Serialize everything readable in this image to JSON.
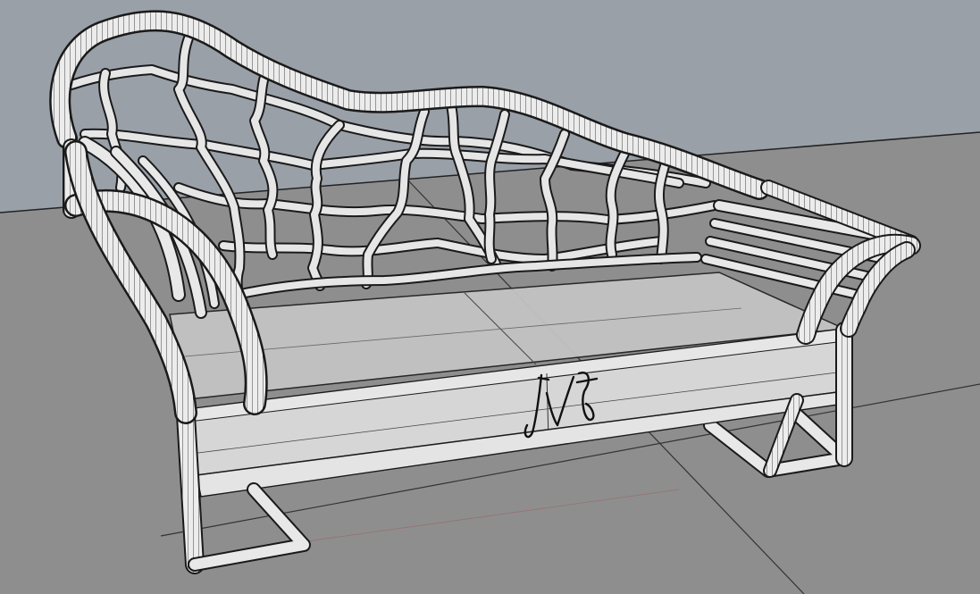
{
  "viewport": {
    "background_color": "#9aa0a8",
    "ground_color": "#8e8e8e",
    "ground_line_color": "#2a2a2a"
  },
  "model": {
    "object": "chaise-longue",
    "display_mode": "shaded-wireframe",
    "tube_fill": "#ebebeb",
    "tube_edge": "#1a1a1a",
    "glass_fill": "#c9c9c9",
    "front_panel_fill": "#d6d6d6",
    "signature_monogram": "JVJ"
  }
}
